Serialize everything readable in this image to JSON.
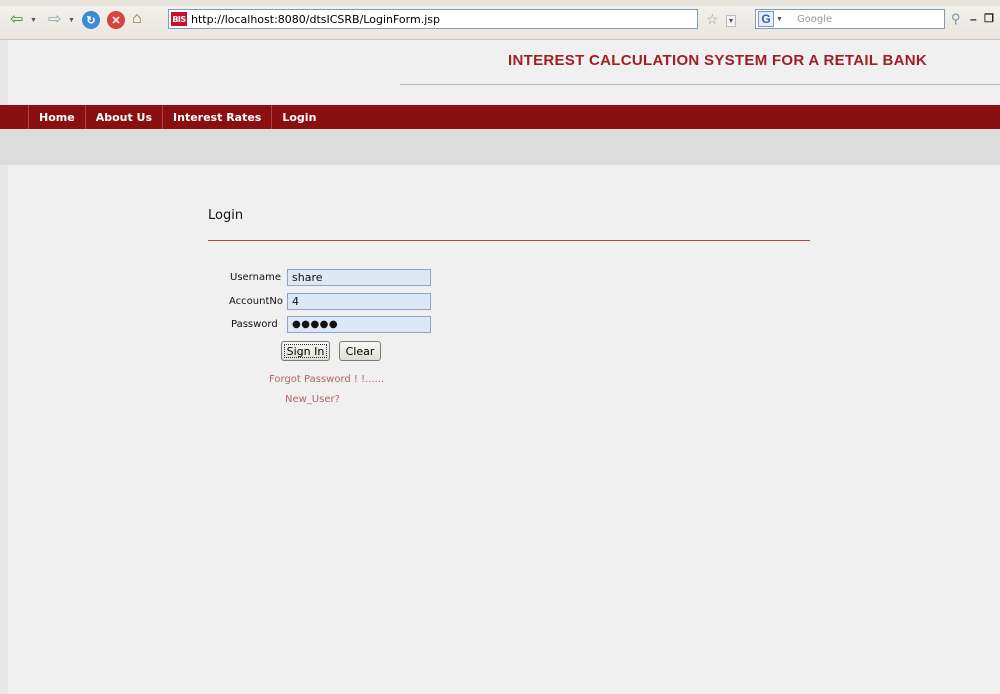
{
  "browser": {
    "url": "http://localhost:8080/dtsICSRB/LoginForm.jsp",
    "favicon_text": "BIS",
    "search_placeholder": "Google",
    "search_engine_letter": "G"
  },
  "site": {
    "title": "INTEREST CALCULATION SYSTEM FOR A RETAIL BANK"
  },
  "nav": {
    "items": [
      {
        "label": "Home"
      },
      {
        "label": "About Us"
      },
      {
        "label": "Interest Rates"
      },
      {
        "label": "Login"
      }
    ]
  },
  "login": {
    "heading": "Login",
    "username_label": "Username",
    "username_value": "share",
    "account_label": "AccountNo",
    "account_value": "4",
    "password_label": "Password",
    "password_value": "●●●●●",
    "signin_label": "Sign In",
    "clear_label": "Clear",
    "forgot_link": "Forgot Password ! !......",
    "new_user_link": "New_User?"
  },
  "colors": {
    "brand_red": "#8b0f0f",
    "title_red": "#a01f23",
    "link_color": "#b06767"
  }
}
